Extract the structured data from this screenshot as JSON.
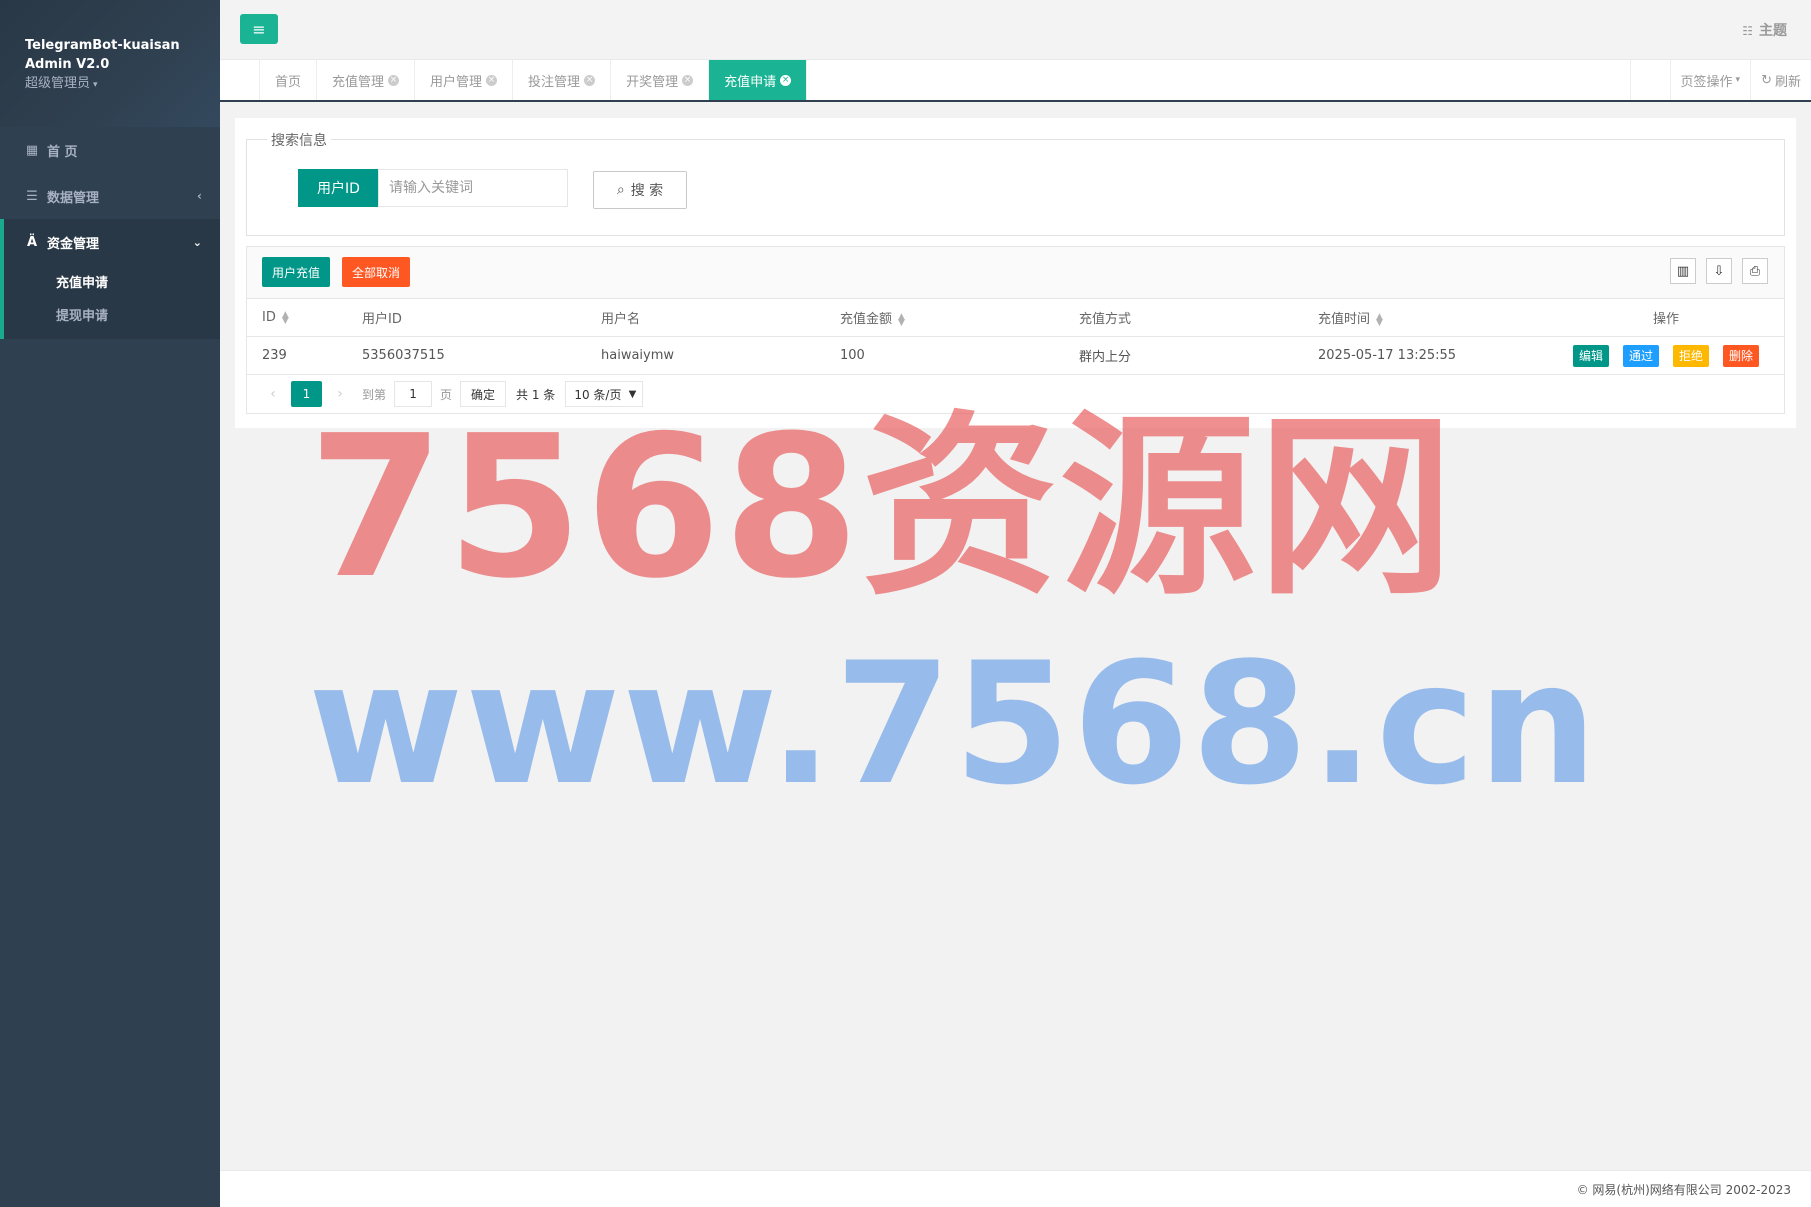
{
  "sidebar": {
    "brand_line1": "TelegramBot-kuaisan",
    "brand_line2": "Admin V2.0",
    "role": "超级管理员",
    "items": [
      {
        "label": "首 页",
        "icon": "dashboard-icon"
      },
      {
        "label": "数据管理",
        "icon": "list-icon"
      },
      {
        "label": "资金管理",
        "icon": "fund-icon",
        "expanded": true,
        "children": [
          {
            "label": "充值申请",
            "current": true
          },
          {
            "label": "提现申请",
            "current": false
          }
        ]
      }
    ]
  },
  "topbar": {
    "theme_label": "主题"
  },
  "tabs": [
    {
      "label": "首页",
      "closable": false
    },
    {
      "label": "充值管理",
      "closable": true
    },
    {
      "label": "用户管理",
      "closable": true
    },
    {
      "label": "投注管理",
      "closable": true
    },
    {
      "label": "开奖管理",
      "closable": true
    },
    {
      "label": "充值申请",
      "closable": true,
      "active": true
    }
  ],
  "tab_actions": {
    "tab_ops": "页签操作",
    "refresh": "刷新"
  },
  "search": {
    "legend": "搜索信息",
    "field_label": "用户ID",
    "placeholder": "请输入关键词",
    "button": "搜 索"
  },
  "toolbar": {
    "recharge": "用户充值",
    "cancel_all": "全部取消"
  },
  "table": {
    "headers": [
      "ID",
      "用户ID",
      "用户名",
      "充值金额",
      "充值方式",
      "充值时间",
      "操作"
    ],
    "rows": [
      {
        "id": "239",
        "user_id": "5356037515",
        "username": "haiwaiymw",
        "amount": "100",
        "method": "群内上分",
        "time": "2025-05-17 13:25:55"
      }
    ],
    "row_actions": {
      "edit": "编辑",
      "pass": "通过",
      "reject": "拒绝",
      "delete": "删除"
    }
  },
  "pager": {
    "current": "1",
    "goto_prefix": "到第",
    "goto_value": "1",
    "goto_suffix": "页",
    "confirm": "确定",
    "total": "共 1 条",
    "page_size": "10 条/页"
  },
  "watermark": {
    "line1": "7568资源网",
    "line2": "www.7568.cn"
  },
  "footer": {
    "copyright": "© 网易(杭州)网络有限公司 2002-2023"
  },
  "colors": {
    "sidebar_bg": "#2f4050",
    "accent": "#1ab394",
    "primary": "#009688",
    "danger": "#ff5722",
    "info": "#1e9fff",
    "warning": "#ffb800"
  }
}
